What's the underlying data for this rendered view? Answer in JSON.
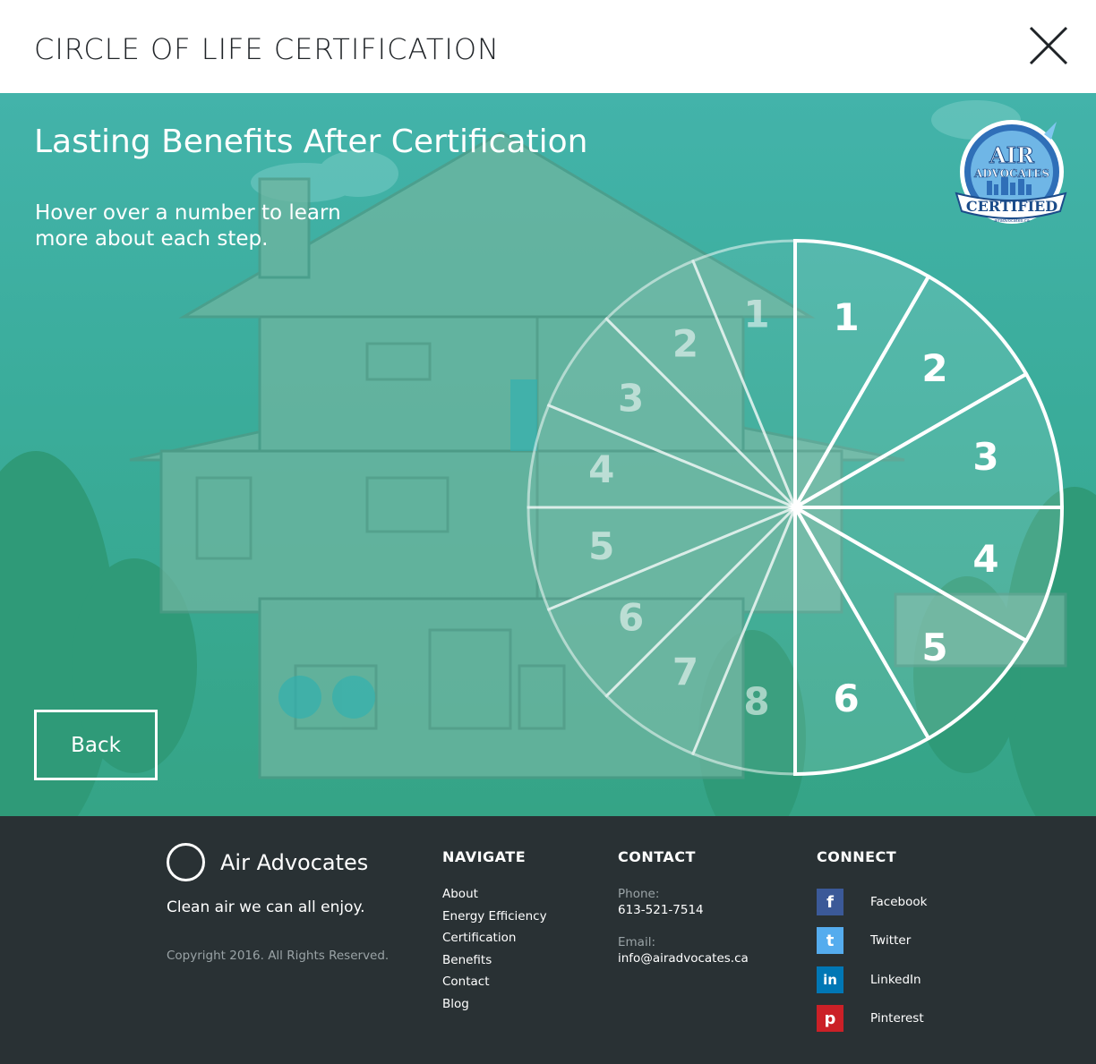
{
  "header": {
    "title": "CIRCLE OF LIFE CERTIFICATION",
    "close_icon": "close-icon"
  },
  "hero": {
    "title": "Lasting Benefits After Certification",
    "subtitle": "Hover over a number to learn more about each step.",
    "back_label": "Back",
    "badge": {
      "line1": "AIR",
      "line2": "ADVOCATES",
      "ribbon": "CERTIFIED",
      "url": "airadvocates.ca"
    },
    "wheel": {
      "right_steps": [
        "1",
        "2",
        "3",
        "4",
        "5",
        "6"
      ],
      "left_steps": [
        "1",
        "2",
        "3",
        "4",
        "5",
        "6",
        "7",
        "8"
      ]
    }
  },
  "footer": {
    "brand_name": "Air Advocates",
    "tagline": "Clean air we can all enjoy.",
    "copyright": "Copyright 2016. All Rights Reserved.",
    "navigate": {
      "title": "NAVIGATE",
      "links": [
        "About",
        "Energy Efficiency",
        "Certification",
        "Benefits",
        "Contact",
        "Blog"
      ]
    },
    "contact": {
      "title": "CONTACT",
      "phone_label": "Phone:",
      "phone": "613-521-7514",
      "email_label": "Email:",
      "email": "info@airadvocates.ca"
    },
    "connect": {
      "title": "CONNECT",
      "items": [
        {
          "label": "Facebook",
          "icon": "facebook-icon",
          "glyph": "f",
          "color": "#3b5998"
        },
        {
          "label": "Twitter",
          "icon": "twitter-icon",
          "glyph": "t",
          "color": "#55acee"
        },
        {
          "label": "LinkedIn",
          "icon": "linkedin-icon",
          "glyph": "in",
          "color": "#0077b5"
        },
        {
          "label": "Pinterest",
          "icon": "pinterest-icon",
          "glyph": "p",
          "color": "#cb2027"
        }
      ]
    }
  },
  "colors": {
    "teal": "#3aac9a",
    "footer": "#293134",
    "white": "#ffffff"
  }
}
